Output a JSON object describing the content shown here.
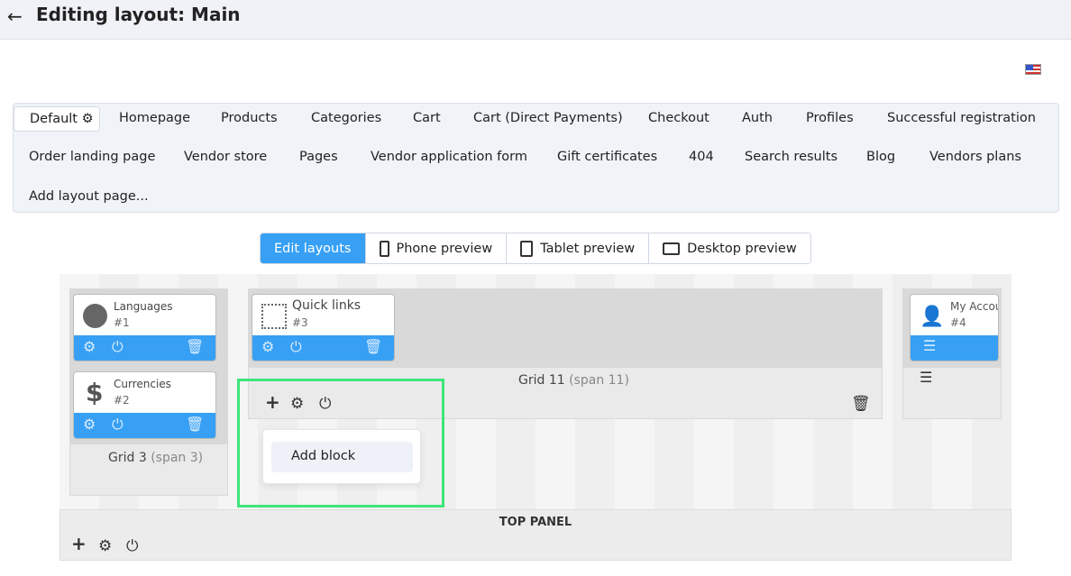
{
  "header": {
    "title": "Editing layout: Main",
    "back_icon": "arrow-left-icon"
  },
  "language_flag": "us-flag-icon",
  "layout_tabs": [
    {
      "label": "Default",
      "active": true
    },
    {
      "label": "Homepage"
    },
    {
      "label": "Products"
    },
    {
      "label": "Categories"
    },
    {
      "label": "Cart"
    },
    {
      "label": "Cart (Direct Payments)"
    },
    {
      "label": "Checkout"
    },
    {
      "label": "Auth"
    },
    {
      "label": "Profiles"
    },
    {
      "label": "Successful registration"
    },
    {
      "label": "Order landing page"
    },
    {
      "label": "Vendor store"
    },
    {
      "label": "Pages"
    },
    {
      "label": "Vendor application form"
    },
    {
      "label": "Gift certificates"
    },
    {
      "label": "404"
    },
    {
      "label": "Search results"
    },
    {
      "label": "Blog"
    },
    {
      "label": "Vendors plans"
    },
    {
      "label": "Add layout page..."
    }
  ],
  "view_modes": [
    {
      "label": "Edit layouts",
      "active": true
    },
    {
      "label": "Phone preview"
    },
    {
      "label": "Tablet preview"
    },
    {
      "label": "Desktop preview"
    }
  ],
  "grids": [
    {
      "name": "Grid 3",
      "span": "(span 3)",
      "blocks": [
        {
          "name": "Languages",
          "id": "#1"
        },
        {
          "name": "Currencies",
          "id": "#2"
        }
      ]
    },
    {
      "name": "Grid 11",
      "span": "(span 11)",
      "blocks": [
        {
          "name": "Quick links",
          "id": "#3"
        }
      ]
    },
    {
      "blocks": [
        {
          "name": "My Account",
          "id": "#4"
        }
      ]
    }
  ],
  "popup": {
    "add_block": "Add block"
  },
  "top_panel": {
    "title": "TOP PANEL"
  },
  "colors": {
    "accent": "#37a0f4",
    "highlight": "#3de57b"
  }
}
